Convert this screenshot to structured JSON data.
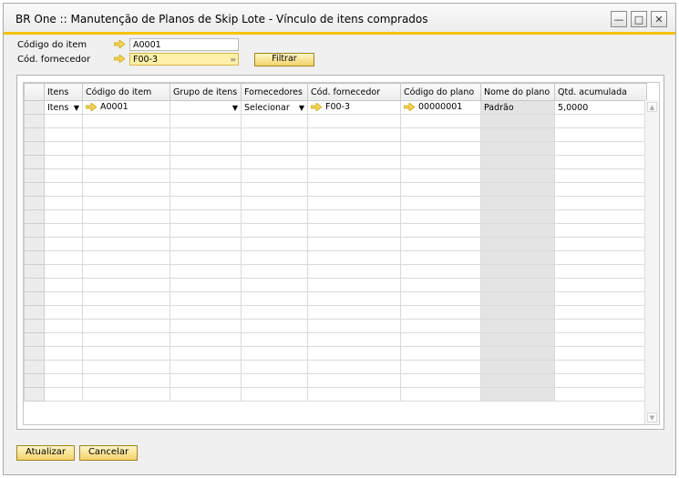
{
  "window": {
    "title": "BR One :: Manutenção de Planos de Skip Lote - Vínculo de itens comprados"
  },
  "form": {
    "item_code_label": "Código do item",
    "item_code_value": "A0001",
    "supplier_label": "Cód. fornecedor",
    "supplier_value": "F00-3",
    "filter_label": "Filtrar"
  },
  "grid": {
    "columns": [
      "Itens",
      "Código do item",
      "Grupo de itens",
      "Fornecedores",
      "Cód. fornecedor",
      "Código do plano",
      "Nome do plano",
      "Qtd. acumulada"
    ],
    "row": {
      "itens": "Itens",
      "item_code": "A0001",
      "item_group": "",
      "suppliers": "Selecionar",
      "supplier_code": "F00-3",
      "plan_code": "00000001",
      "plan_name": "Padrão",
      "accumulated_qty": "5,0000"
    }
  },
  "buttons": {
    "update": "Atualizar",
    "cancel": "Cancelar"
  },
  "colors": {
    "accent": "#f5c400",
    "button": "#f3d36a",
    "link_arrow": "#e8b400"
  }
}
